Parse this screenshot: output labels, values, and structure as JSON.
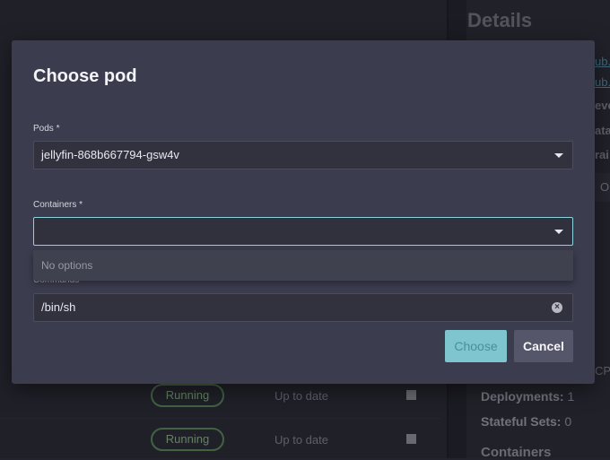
{
  "background": {
    "details_title": "Details",
    "right_peek": [
      {
        "text": "ub.",
        "kind": "link"
      },
      {
        "text": "ub.",
        "kind": "link"
      },
      {
        "text": "eve",
        "kind": "text"
      },
      {
        "text": "ata",
        "kind": "text"
      },
      {
        "text": "rai",
        "kind": "text"
      }
    ],
    "peek_box_text": "O",
    "peek_cp_text": "CP",
    "rows": [
      {
        "status": "Running",
        "update": "Up to date"
      },
      {
        "status": "Running",
        "update": "Up to date"
      }
    ],
    "stats": [
      {
        "label": "Deployments:",
        "value": "1"
      },
      {
        "label": "Stateful Sets:",
        "value": "0"
      }
    ],
    "containers_heading": "Containers"
  },
  "dialog": {
    "title": "Choose pod",
    "pods_label": "Pods *",
    "pods_value": "jellyfin-868b667794-gsw4v",
    "containers_label": "Containers *",
    "containers_value": "",
    "no_options": "No options",
    "commands_label": "Commands",
    "commands_value": "/bin/sh",
    "choose_label": "Choose",
    "cancel_label": "Cancel"
  },
  "icons": {
    "dropdown": "chevron-down-icon",
    "clear": "clear-icon"
  },
  "colors": {
    "accent": "#7fc5cf",
    "focus_border": "#8cd3df",
    "running": "#8fc089"
  }
}
